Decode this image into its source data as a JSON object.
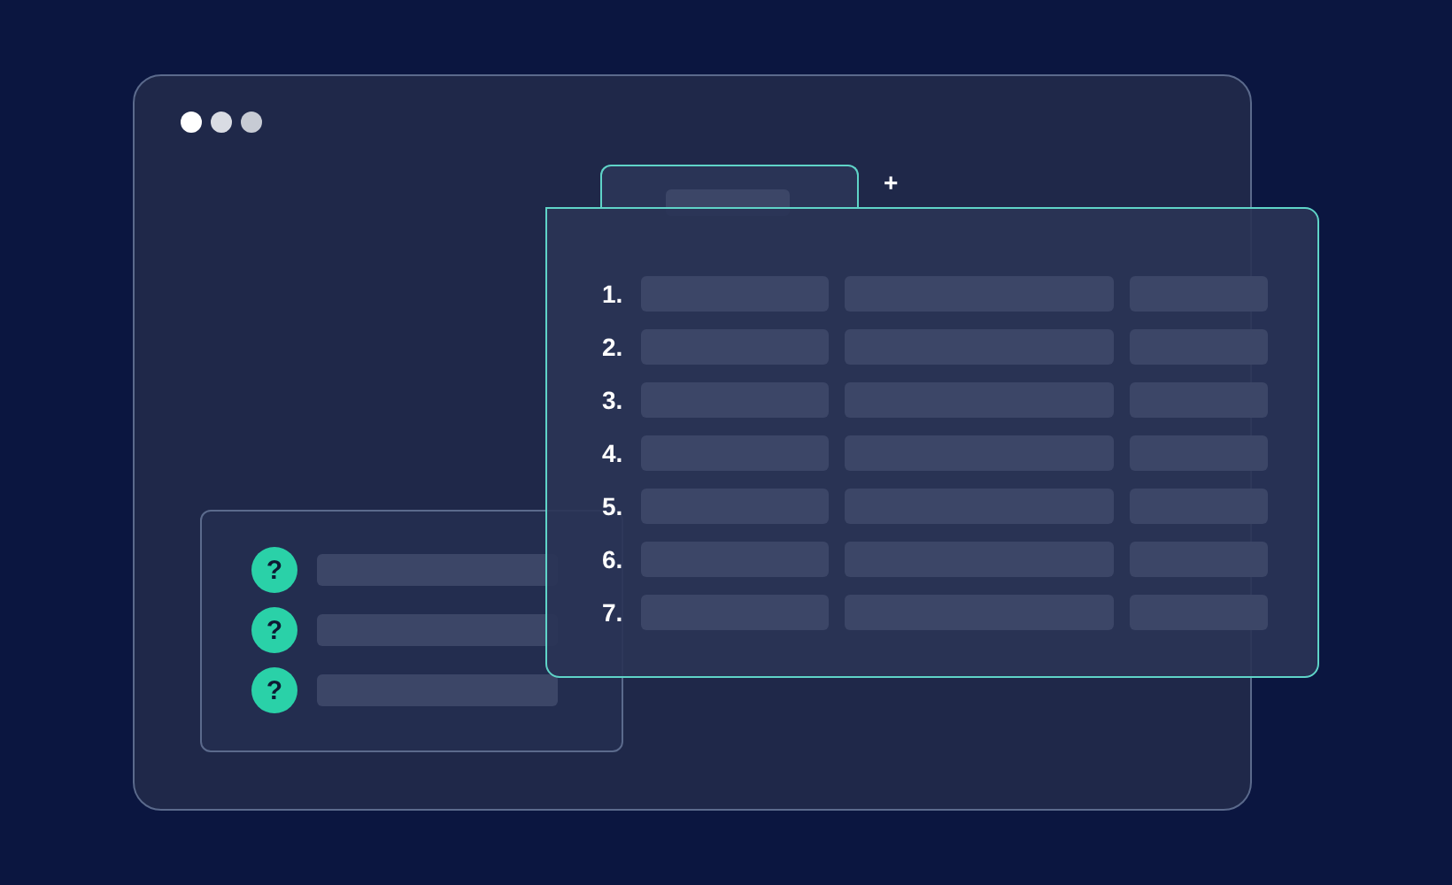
{
  "tab_bar": {
    "add_label": "+"
  },
  "table": {
    "rows": [
      {
        "number": "1."
      },
      {
        "number": "2."
      },
      {
        "number": "3."
      },
      {
        "number": "4."
      },
      {
        "number": "5."
      },
      {
        "number": "6."
      },
      {
        "number": "7."
      }
    ]
  },
  "help_list": {
    "items": [
      {
        "icon": "?"
      },
      {
        "icon": "?"
      },
      {
        "icon": "?"
      }
    ]
  }
}
